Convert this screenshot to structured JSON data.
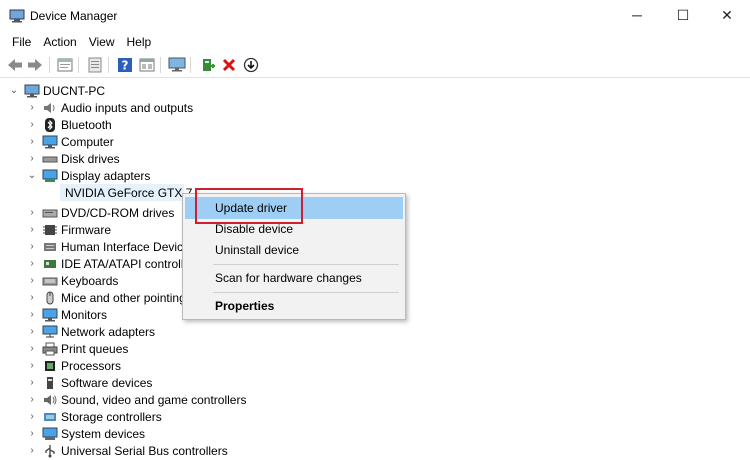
{
  "window": {
    "title": "Device Manager"
  },
  "window_controls": {
    "minimize": "─",
    "maximize": "☐",
    "close": "✕"
  },
  "menu": [
    {
      "label": "File"
    },
    {
      "label": "Action"
    },
    {
      "label": "View"
    },
    {
      "label": "Help"
    }
  ],
  "toolbar": {
    "buttons": [
      "back-icon",
      "forward-icon",
      "properties-icon",
      "show-hidden-icon",
      "help-icon",
      "details-icon",
      "monitor-icon",
      "add-driver-icon",
      "uninstall-icon",
      "update-icon"
    ]
  },
  "tree": {
    "root": "DUCNT-PC",
    "categories": [
      {
        "label": "Audio inputs and outputs",
        "icon": "speaker-icon"
      },
      {
        "label": "Bluetooth",
        "icon": "bluetooth-icon"
      },
      {
        "label": "Computer",
        "icon": "computer-icon"
      },
      {
        "label": "Disk drives",
        "icon": "disk-icon"
      },
      {
        "label": "Display adapters",
        "icon": "display-adapter-icon",
        "expanded": true,
        "children": [
          {
            "label": "NVIDIA GeForce GTX 7…"
          }
        ]
      },
      {
        "label": "DVD/CD-ROM drives",
        "icon": "dvd-icon"
      },
      {
        "label": "Firmware",
        "icon": "firmware-icon"
      },
      {
        "label": "Human Interface Devic…",
        "icon": "hid-icon"
      },
      {
        "label": "IDE ATA/ATAPI controll…",
        "icon": "ide-icon"
      },
      {
        "label": "Keyboards",
        "icon": "keyboard-icon"
      },
      {
        "label": "Mice and other pointing…",
        "icon": "mouse-icon"
      },
      {
        "label": "Monitors",
        "icon": "monitor-icon"
      },
      {
        "label": "Network adapters",
        "icon": "network-icon"
      },
      {
        "label": "Print queues",
        "icon": "printer-icon"
      },
      {
        "label": "Processors",
        "icon": "processor-icon"
      },
      {
        "label": "Software devices",
        "icon": "software-icon"
      },
      {
        "label": "Sound, video and game controllers",
        "icon": "sound-icon"
      },
      {
        "label": "Storage controllers",
        "icon": "storage-icon"
      },
      {
        "label": "System devices",
        "icon": "system-icon"
      },
      {
        "label": "Universal Serial Bus controllers",
        "icon": "usb-icon"
      }
    ]
  },
  "context_menu": {
    "update": "Update driver",
    "disable": "Disable device",
    "uninstall": "Uninstall device",
    "scan": "Scan for hardware changes",
    "properties": "Properties"
  },
  "colors": {
    "highlight_box": "#d0202f",
    "menu_hover": "#9fcef4",
    "selection": "#e5f1fb"
  }
}
